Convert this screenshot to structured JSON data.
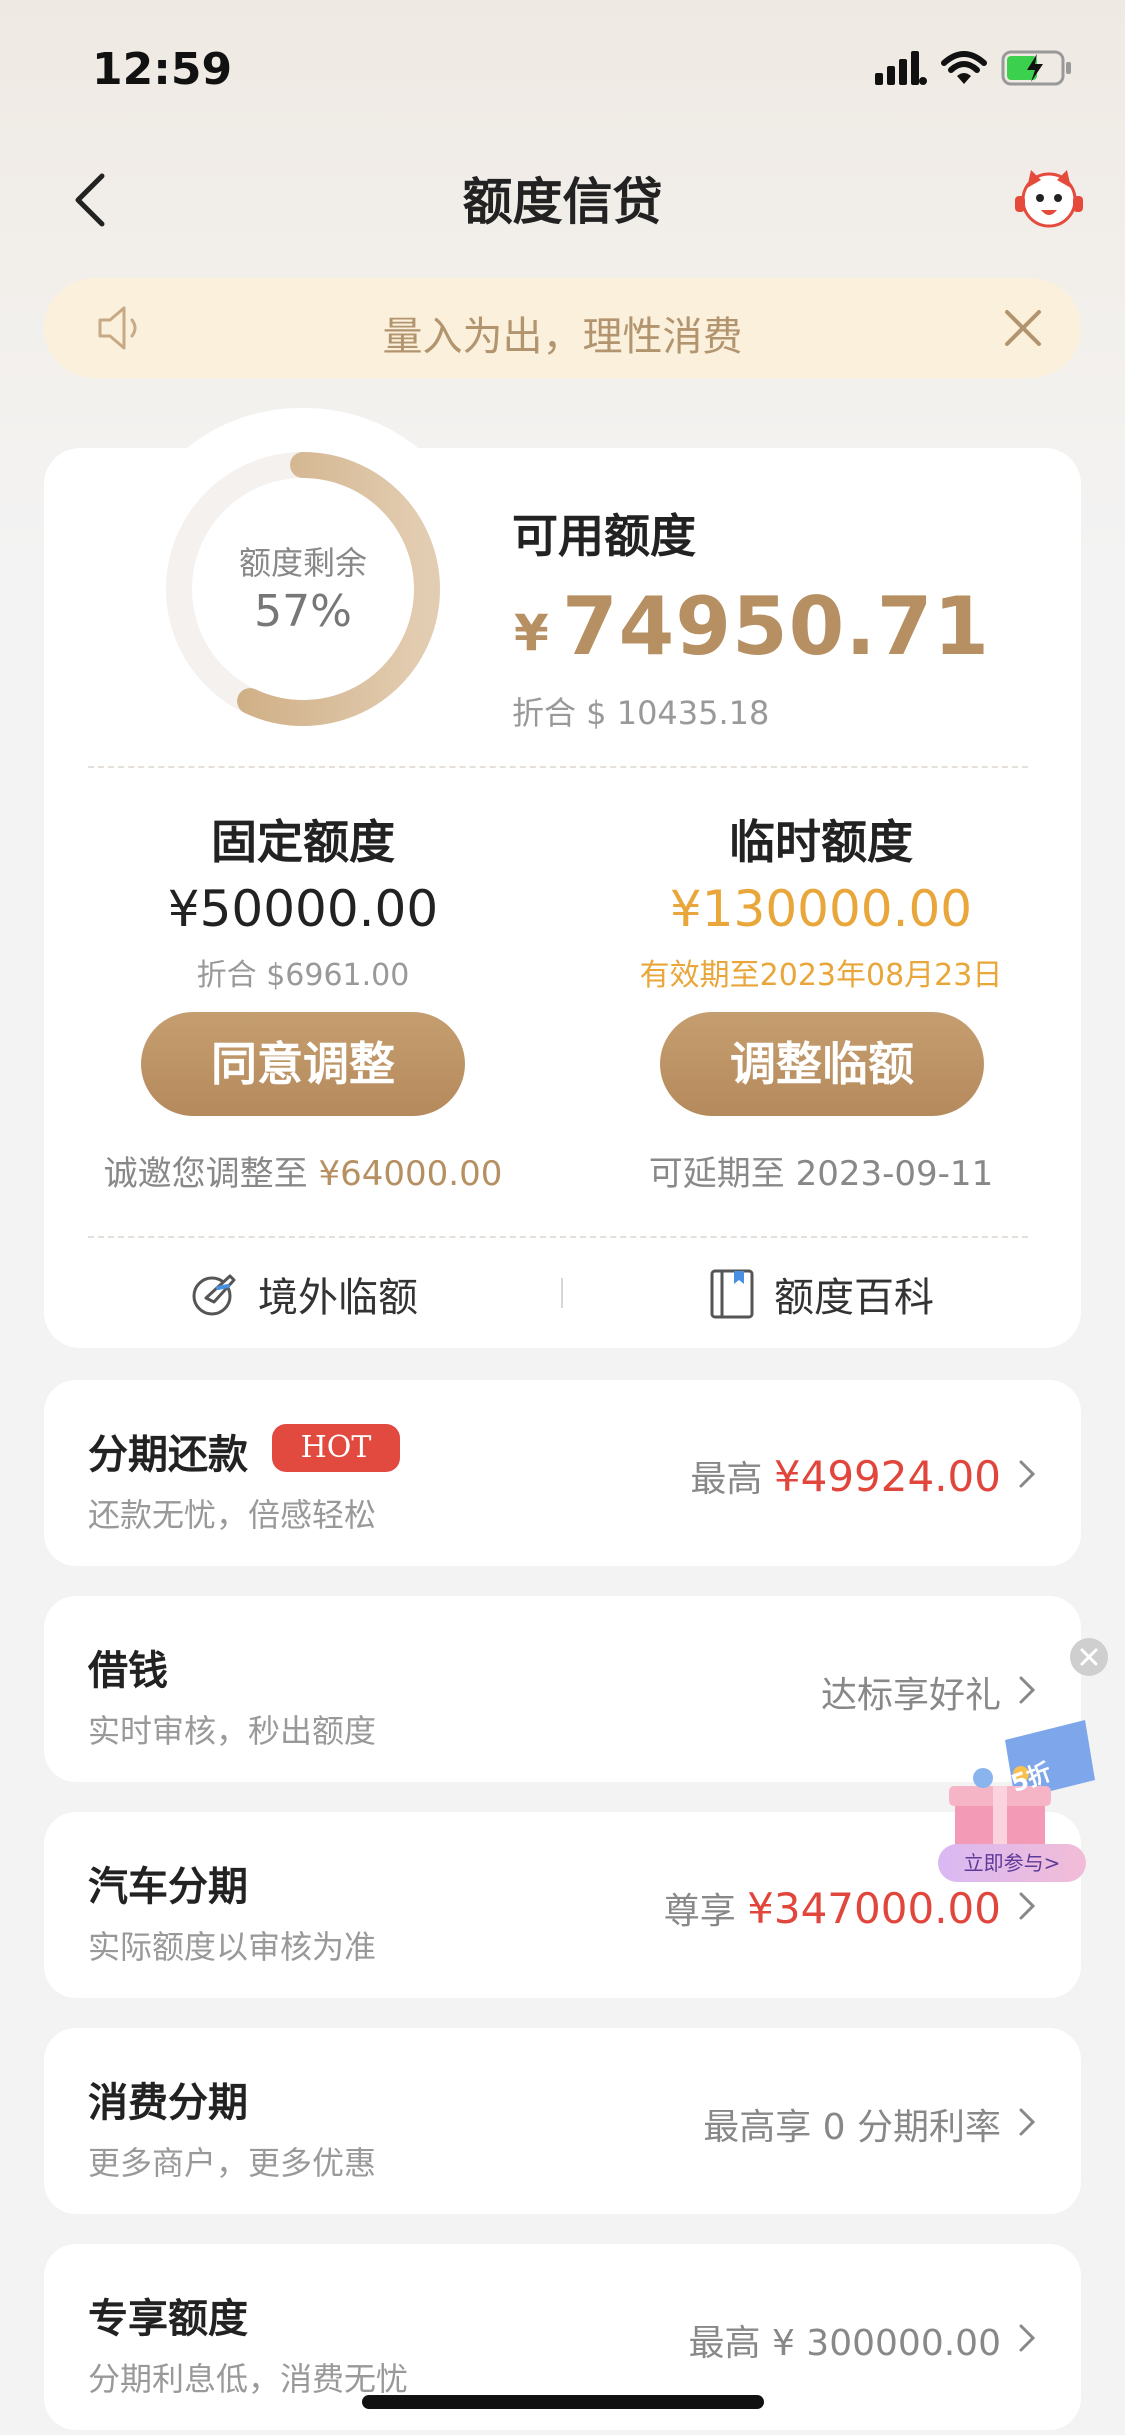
{
  "status_bar": {
    "time": "12:59"
  },
  "nav": {
    "title": "额度信贷"
  },
  "notice": {
    "text": "量入为出，理性消费"
  },
  "quota_ring": {
    "label": "额度剩余",
    "percent_text": "57%",
    "remaining_fraction": 0.57
  },
  "available": {
    "label": "可用额度",
    "currency": "¥",
    "amount": "74950.71",
    "converted": "折合 $ 10435.18"
  },
  "fixed": {
    "title": "固定额度",
    "amount": "¥50000.00",
    "converted": "折合 $6961.00",
    "button": "同意调整",
    "note_prefix": "诚邀您调整至 ",
    "note_amount": "¥64000.00"
  },
  "temporary": {
    "title": "临时额度",
    "amount": "¥130000.00",
    "validity": "有效期至2023年08月23日",
    "button": "调整临额",
    "note": "可延期至 2023-09-11"
  },
  "links": {
    "overseas": "境外临额",
    "encyclopedia": "额度百科"
  },
  "list": [
    {
      "title": "分期还款",
      "badge": "HOT",
      "subtitle": "还款无忧，倍感轻松",
      "right_prefix": "最高 ",
      "right_amount": "¥49924.00"
    },
    {
      "title": "借钱",
      "subtitle": "实时审核，秒出额度",
      "right_text": "达标享好礼"
    },
    {
      "title": "汽车分期",
      "subtitle": "实际额度以审核为准",
      "right_prefix": "尊享 ",
      "right_amount": "¥347000.00"
    },
    {
      "title": "消费分期",
      "subtitle": "更多商户，更多优惠",
      "right_text": "最高享 0 分期利率"
    },
    {
      "title": "专享额度",
      "subtitle": "分期利息低，消费无忧",
      "right_text": "最高 ¥ 300000.00"
    }
  ],
  "promo": {
    "discount": "5折",
    "button": "立即参与>"
  },
  "colors": {
    "gold": "#b69062",
    "orange": "#e9a63a",
    "red": "#e0463c",
    "hot": "#e2493f"
  }
}
